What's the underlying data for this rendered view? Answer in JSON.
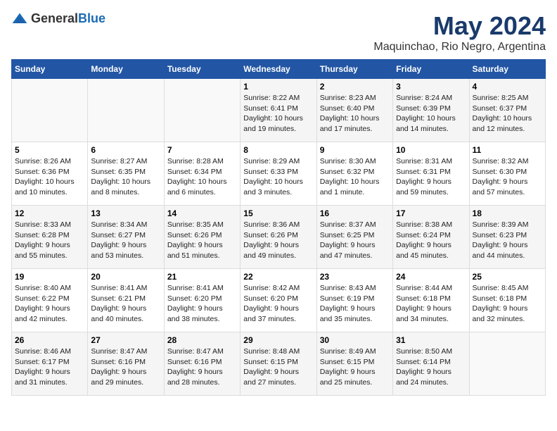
{
  "logo": {
    "general": "General",
    "blue": "Blue"
  },
  "title": "May 2024",
  "subtitle": "Maquinchao, Rio Negro, Argentina",
  "days_of_week": [
    "Sunday",
    "Monday",
    "Tuesday",
    "Wednesday",
    "Thursday",
    "Friday",
    "Saturday"
  ],
  "weeks": [
    [
      {
        "day": "",
        "info": ""
      },
      {
        "day": "",
        "info": ""
      },
      {
        "day": "",
        "info": ""
      },
      {
        "day": "1",
        "info": "Sunrise: 8:22 AM\nSunset: 6:41 PM\nDaylight: 10 hours\nand 19 minutes."
      },
      {
        "day": "2",
        "info": "Sunrise: 8:23 AM\nSunset: 6:40 PM\nDaylight: 10 hours\nand 17 minutes."
      },
      {
        "day": "3",
        "info": "Sunrise: 8:24 AM\nSunset: 6:39 PM\nDaylight: 10 hours\nand 14 minutes."
      },
      {
        "day": "4",
        "info": "Sunrise: 8:25 AM\nSunset: 6:37 PM\nDaylight: 10 hours\nand 12 minutes."
      }
    ],
    [
      {
        "day": "5",
        "info": "Sunrise: 8:26 AM\nSunset: 6:36 PM\nDaylight: 10 hours\nand 10 minutes."
      },
      {
        "day": "6",
        "info": "Sunrise: 8:27 AM\nSunset: 6:35 PM\nDaylight: 10 hours\nand 8 minutes."
      },
      {
        "day": "7",
        "info": "Sunrise: 8:28 AM\nSunset: 6:34 PM\nDaylight: 10 hours\nand 6 minutes."
      },
      {
        "day": "8",
        "info": "Sunrise: 8:29 AM\nSunset: 6:33 PM\nDaylight: 10 hours\nand 3 minutes."
      },
      {
        "day": "9",
        "info": "Sunrise: 8:30 AM\nSunset: 6:32 PM\nDaylight: 10 hours\nand 1 minute."
      },
      {
        "day": "10",
        "info": "Sunrise: 8:31 AM\nSunset: 6:31 PM\nDaylight: 9 hours\nand 59 minutes."
      },
      {
        "day": "11",
        "info": "Sunrise: 8:32 AM\nSunset: 6:30 PM\nDaylight: 9 hours\nand 57 minutes."
      }
    ],
    [
      {
        "day": "12",
        "info": "Sunrise: 8:33 AM\nSunset: 6:28 PM\nDaylight: 9 hours\nand 55 minutes."
      },
      {
        "day": "13",
        "info": "Sunrise: 8:34 AM\nSunset: 6:27 PM\nDaylight: 9 hours\nand 53 minutes."
      },
      {
        "day": "14",
        "info": "Sunrise: 8:35 AM\nSunset: 6:26 PM\nDaylight: 9 hours\nand 51 minutes."
      },
      {
        "day": "15",
        "info": "Sunrise: 8:36 AM\nSunset: 6:26 PM\nDaylight: 9 hours\nand 49 minutes."
      },
      {
        "day": "16",
        "info": "Sunrise: 8:37 AM\nSunset: 6:25 PM\nDaylight: 9 hours\nand 47 minutes."
      },
      {
        "day": "17",
        "info": "Sunrise: 8:38 AM\nSunset: 6:24 PM\nDaylight: 9 hours\nand 45 minutes."
      },
      {
        "day": "18",
        "info": "Sunrise: 8:39 AM\nSunset: 6:23 PM\nDaylight: 9 hours\nand 44 minutes."
      }
    ],
    [
      {
        "day": "19",
        "info": "Sunrise: 8:40 AM\nSunset: 6:22 PM\nDaylight: 9 hours\nand 42 minutes."
      },
      {
        "day": "20",
        "info": "Sunrise: 8:41 AM\nSunset: 6:21 PM\nDaylight: 9 hours\nand 40 minutes."
      },
      {
        "day": "21",
        "info": "Sunrise: 8:41 AM\nSunset: 6:20 PM\nDaylight: 9 hours\nand 38 minutes."
      },
      {
        "day": "22",
        "info": "Sunrise: 8:42 AM\nSunset: 6:20 PM\nDaylight: 9 hours\nand 37 minutes."
      },
      {
        "day": "23",
        "info": "Sunrise: 8:43 AM\nSunset: 6:19 PM\nDaylight: 9 hours\nand 35 minutes."
      },
      {
        "day": "24",
        "info": "Sunrise: 8:44 AM\nSunset: 6:18 PM\nDaylight: 9 hours\nand 34 minutes."
      },
      {
        "day": "25",
        "info": "Sunrise: 8:45 AM\nSunset: 6:18 PM\nDaylight: 9 hours\nand 32 minutes."
      }
    ],
    [
      {
        "day": "26",
        "info": "Sunrise: 8:46 AM\nSunset: 6:17 PM\nDaylight: 9 hours\nand 31 minutes."
      },
      {
        "day": "27",
        "info": "Sunrise: 8:47 AM\nSunset: 6:16 PM\nDaylight: 9 hours\nand 29 minutes."
      },
      {
        "day": "28",
        "info": "Sunrise: 8:47 AM\nSunset: 6:16 PM\nDaylight: 9 hours\nand 28 minutes."
      },
      {
        "day": "29",
        "info": "Sunrise: 8:48 AM\nSunset: 6:15 PM\nDaylight: 9 hours\nand 27 minutes."
      },
      {
        "day": "30",
        "info": "Sunrise: 8:49 AM\nSunset: 6:15 PM\nDaylight: 9 hours\nand 25 minutes."
      },
      {
        "day": "31",
        "info": "Sunrise: 8:50 AM\nSunset: 6:14 PM\nDaylight: 9 hours\nand 24 minutes."
      },
      {
        "day": "",
        "info": ""
      }
    ]
  ]
}
